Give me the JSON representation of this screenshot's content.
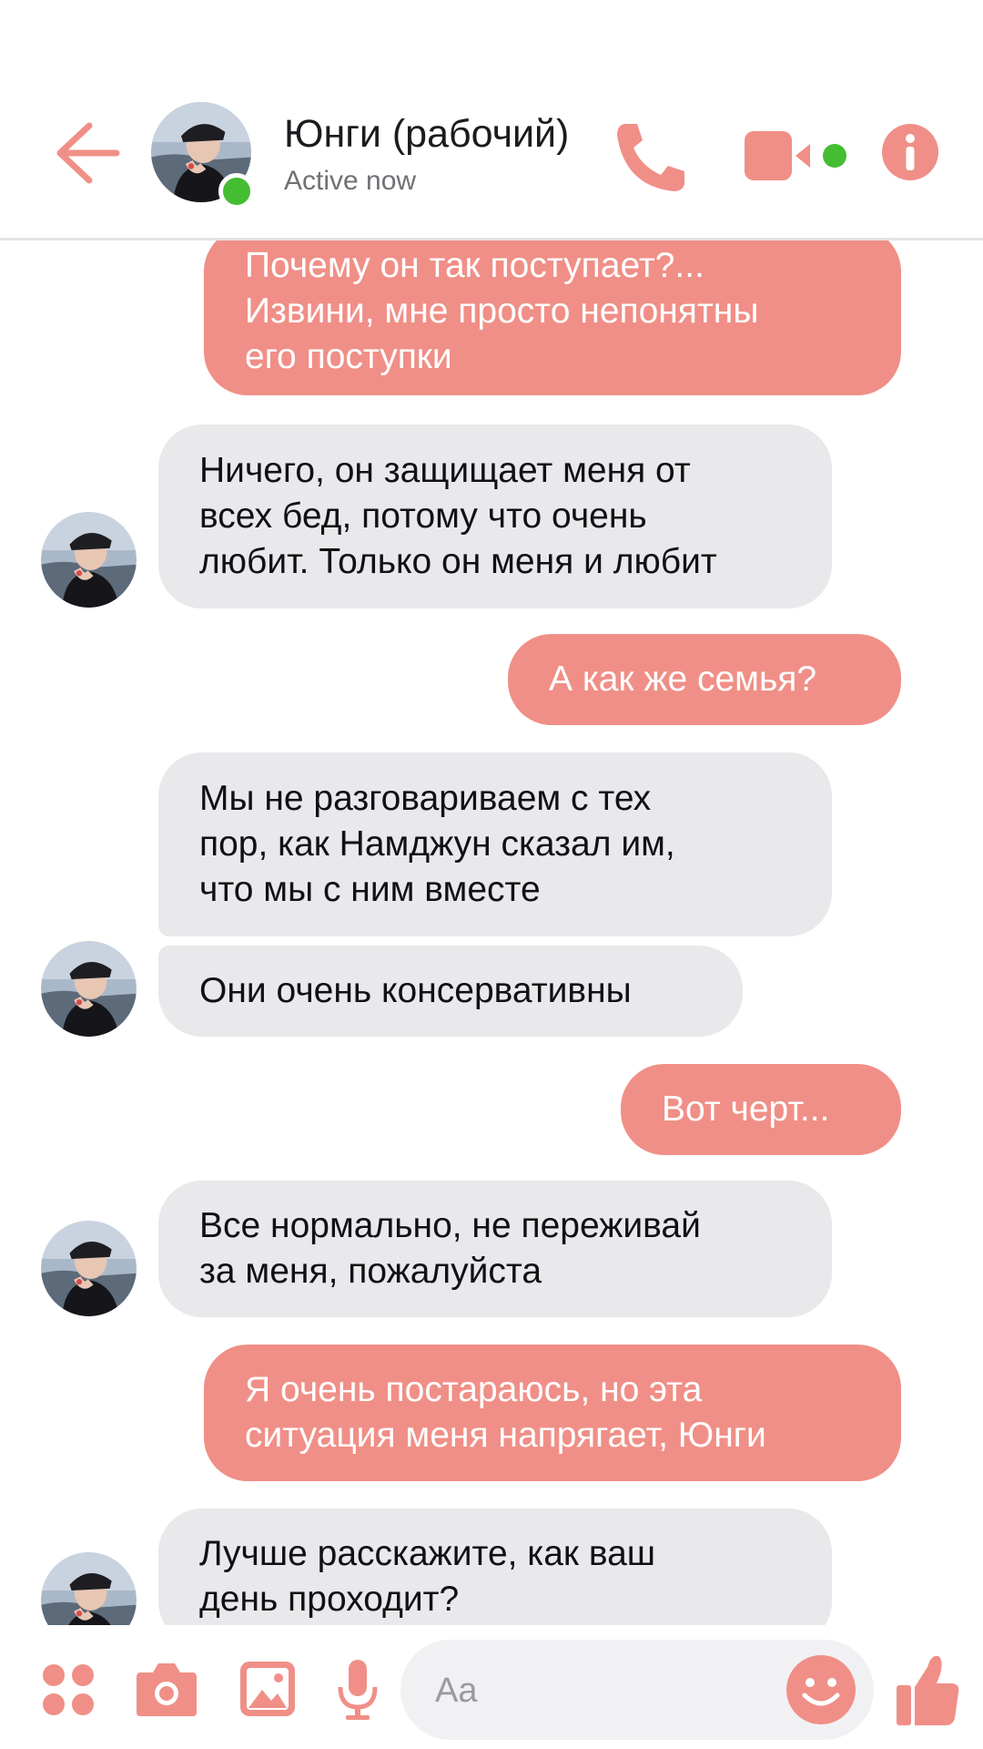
{
  "header": {
    "contact_name": "Юнги (рабочий)",
    "status": "Active now",
    "online": true
  },
  "messages": [
    {
      "from": "me",
      "lines": [
        "Почему он так поступает?...",
        "Извини, мне просто непонятны",
        "его поступки"
      ]
    },
    {
      "from": "contact",
      "lines": [
        "Ничего, он защищает меня от",
        "всех бед, потому что очень",
        "любит. Только он меня и любит"
      ]
    },
    {
      "from": "me",
      "lines": [
        "А как же семья?"
      ]
    },
    {
      "from": "contact",
      "lines": [
        "Мы не разговариваем с тех",
        "пор, как Намджун сказал им,",
        "что мы с ним вместе"
      ]
    },
    {
      "from": "contact",
      "lines": [
        "Они очень консервативны"
      ]
    },
    {
      "from": "me",
      "lines": [
        "Вот черт..."
      ]
    },
    {
      "from": "contact",
      "lines": [
        "Все нормально, не переживай",
        "за меня, пожалуйста"
      ]
    },
    {
      "from": "me",
      "lines": [
        "Я очень постараюсь, но эта",
        "ситуация меня напрягает, Юнги"
      ]
    },
    {
      "from": "contact",
      "lines": [
        "Лучше расскажите, как ваш",
        "день проходит?"
      ]
    }
  ],
  "composer": {
    "placeholder": "Aa"
  },
  "icons": {
    "back": "arrow-left-icon",
    "call": "phone-icon",
    "video": "video-camera-icon",
    "info": "info-icon",
    "apps": "four-dots-icon",
    "camera": "camera-icon",
    "gallery": "image-icon",
    "voice": "microphone-icon",
    "emoji": "smiley-icon",
    "like": "thumbs-up-icon"
  },
  "colors": {
    "accent": "#f08f87",
    "incoming_bubble": "#e9e9ec",
    "online": "#44bd32"
  }
}
